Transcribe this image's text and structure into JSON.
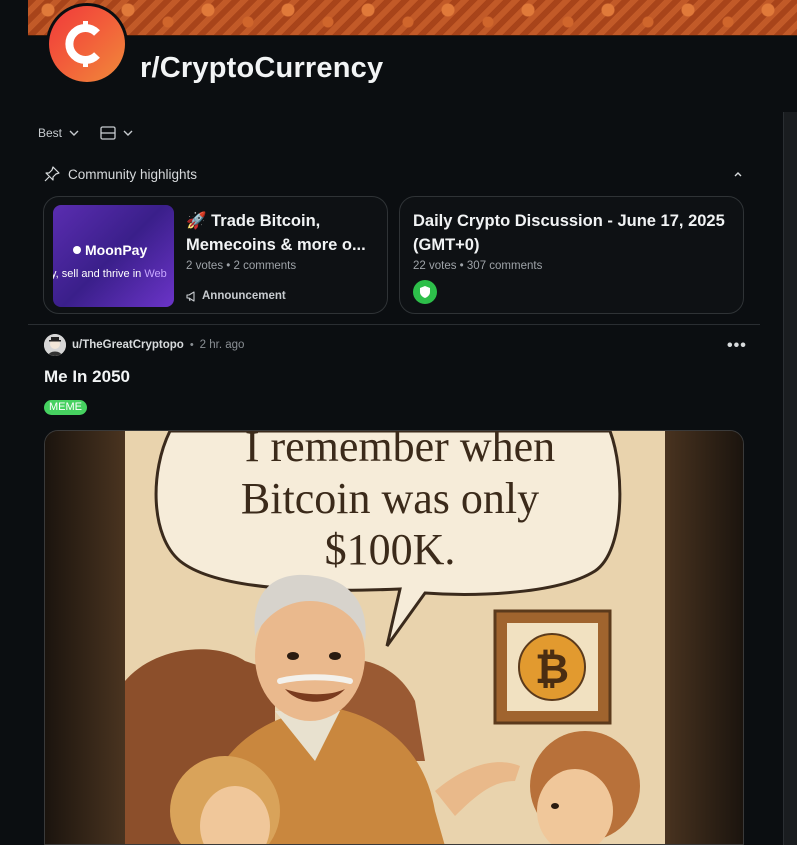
{
  "subreddit": {
    "name": "r/CryptoCurrency",
    "colors": {
      "accent": "#f25b3a",
      "banner": "#b24b1f"
    }
  },
  "controls": {
    "sort_label": "Best",
    "view_icon": "layout-icon"
  },
  "highlights": {
    "header": "Community highlights",
    "cards": [
      {
        "thumb_brand": "MoonPay",
        "thumb_tagline_pre": "y, sell and thrive in ",
        "thumb_tagline_accent": "Web",
        "title": "🚀 Trade Bitcoin, Memecoins & more o...",
        "votes": "2 votes",
        "comments": "2 comments",
        "tag": "Announcement"
      },
      {
        "title": "Daily Crypto Discussion - June 17, 2025 (GMT+0)",
        "votes": "22 votes",
        "comments": "307 comments",
        "badge_color": "#2dbf4a"
      }
    ]
  },
  "post": {
    "author": "u/TheGreatCryptopo",
    "time": "2 hr. ago",
    "title": "Me In 2050",
    "flair": "MEME",
    "flair_color": "#46d160",
    "image": {
      "speech_line1": "I remember when",
      "speech_line2": "Bitcoin was only",
      "speech_line3": "$100K."
    }
  }
}
